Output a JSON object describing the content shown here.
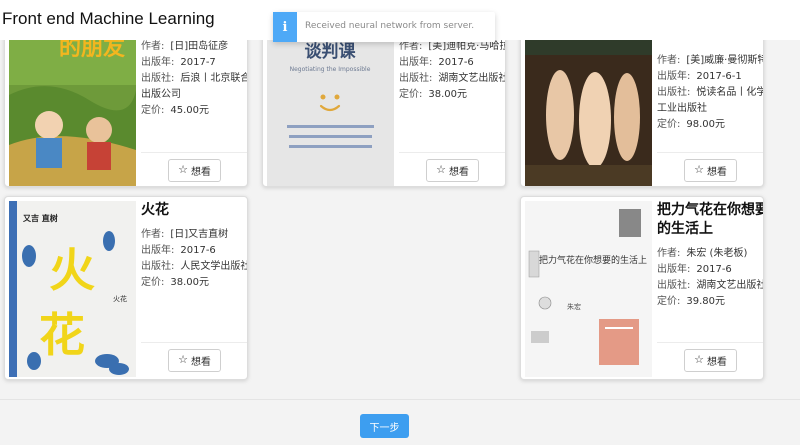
{
  "app": {
    "title": "Front end Machine Learning"
  },
  "toast": {
    "icon": "info-icon",
    "icon_glyph": "i",
    "message": "Received neural network from server."
  },
  "labels": {
    "author": "作者:",
    "published": "出版年:",
    "publisher": "出版社:",
    "price": "定价:"
  },
  "want_button": {
    "label": "想看",
    "icon": "star-outline-icon"
  },
  "books": [
    {
      "author": "[日]田岛征彦",
      "published": "2017-7",
      "publisher": "后浪丨北京联合出版公司",
      "price": "45.00元",
      "cover_text": "的朋友"
    },
    {
      "author": "[美]迪帕克·马哈拉",
      "published": "2017-6",
      "publisher": "湖南文艺出版社",
      "price": "38.00元",
      "cover_text": "谈判课",
      "cover_subtitle": "Negotiating the Impossible"
    },
    {
      "author": "[美]威廉·曼彻斯特",
      "published": "2017-6-1",
      "publisher": "悦读名品丨化学工业出版社",
      "price": "98.00元"
    },
    {
      "title": "火花",
      "author": "[日]又吉直树",
      "published": "2017-6",
      "publisher": "人民文学出版社",
      "price": "38.00元",
      "cover_title": "火",
      "cover_title2": "花",
      "cover_author": "又吉 直树",
      "cover_label": "火花"
    },
    {
      "title": "把力气花在你想要的生活上",
      "author": "朱宏 (朱老板)",
      "published": "2017-6",
      "publisher": "湖南文艺出版社",
      "price": "39.80元",
      "cover_title": "把力气花在你想要的生活上",
      "cover_author": "朱宏"
    }
  ],
  "footer": {
    "next_label": "下一步"
  }
}
